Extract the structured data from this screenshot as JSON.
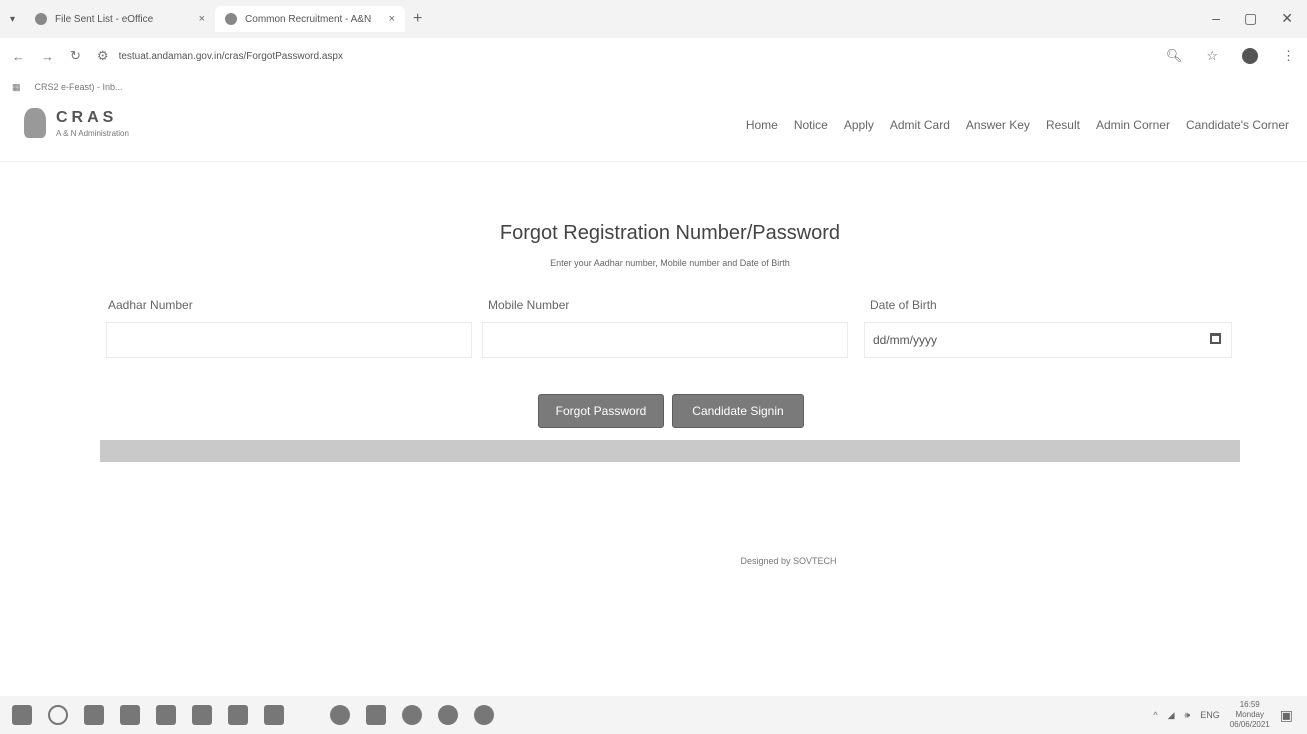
{
  "browser": {
    "tabs": [
      {
        "label": "File Sent List - eOffice",
        "active": false
      },
      {
        "label": "Common Recruitment - A&N",
        "active": true
      }
    ],
    "new_tab": "+",
    "url": "testuat.andaman.gov.in/cras/ForgotPassword.aspx",
    "bookmark": "CRS2 e-Feast) - Inb..."
  },
  "site": {
    "logo_title": "CRAS",
    "logo_subtitle": "A & N Administration",
    "menu": [
      "Home",
      "Notice",
      "Apply",
      "Admit Card",
      "Answer Key",
      "Result",
      "Admin Corner",
      "Candidate's Corner"
    ]
  },
  "form": {
    "title": "Forgot Registration Number/Password",
    "subtitle": "Enter your Aadhar number, Mobile number and Date of Birth",
    "aadhar_label": "Aadhar Number",
    "mobile_label": "Mobile Number",
    "dob_label": "Date of Birth",
    "dob_placeholder": "dd/mm/yyyy",
    "forgot_button": "Forgot Password",
    "signin_button": "Candidate Signin"
  },
  "footer": {
    "text": "Designed by SOVTECH"
  },
  "taskbar": {
    "time": "16:59",
    "day": "Monday",
    "date": "06/06/2021",
    "lang": "ENG"
  }
}
